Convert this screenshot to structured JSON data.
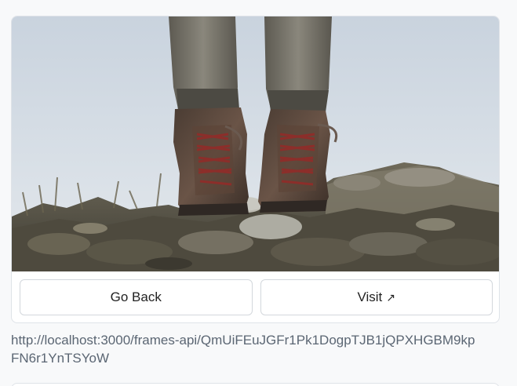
{
  "frame": {
    "image_subject": "hiking-boots-on-rocks",
    "buttons": {
      "back_label": "Go Back",
      "visit_label": "Visit",
      "visit_icon": "↗"
    },
    "url": "http://localhost:3000/frames-api/QmUiFEuJGFr1Pk1DogpTJB1jQPXHGBM9kpFN6r1YnTSYoW"
  }
}
